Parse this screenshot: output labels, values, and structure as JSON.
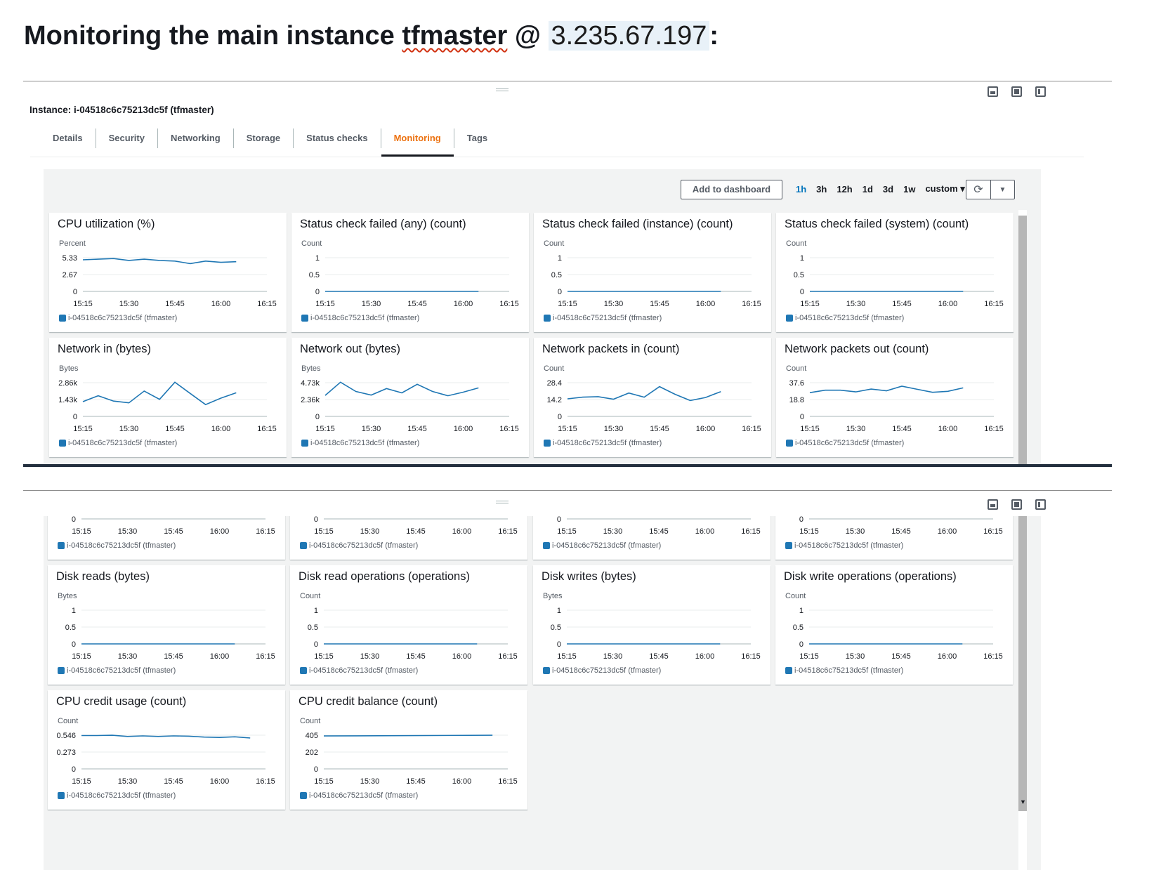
{
  "heading": {
    "prefix": "Monitoring the main instance ",
    "name": "tfmaster",
    "mid": " @ ",
    "ip": "3.235.67.197",
    "suffix": ":"
  },
  "instance_title": "Instance: i-04518c6c75213dc5f (tfmaster)",
  "tabs": [
    {
      "label": "Details",
      "active": false
    },
    {
      "label": "Security",
      "active": false
    },
    {
      "label": "Networking",
      "active": false
    },
    {
      "label": "Storage",
      "active": false
    },
    {
      "label": "Status checks",
      "active": false
    },
    {
      "label": "Monitoring",
      "active": true
    },
    {
      "label": "Tags",
      "active": false
    }
  ],
  "toolbar": {
    "add_to_dashboard": "Add to dashboard",
    "ranges": [
      "1h",
      "3h",
      "12h",
      "1d",
      "3d",
      "1w"
    ],
    "active_range": "1h",
    "custom": "custom ▾",
    "refresh_icon": "refresh-icon",
    "dropdown_icon": "caret-down-icon"
  },
  "colors": {
    "series": "#1f77b4",
    "active_tab": "#ec7211",
    "active_range": "#0073bb"
  },
  "legend_label": "i-04518c6c75213dc5f (tfmaster)",
  "chart_data": [
    {
      "id": "cpu",
      "type": "line",
      "title": "CPU utilization (%)",
      "ylabel": "Percent",
      "yticks": [
        "5.33",
        "2.67",
        "0"
      ],
      "ylim": [
        0,
        5.33
      ],
      "xticks": [
        "15:15",
        "15:30",
        "15:45",
        "16:00",
        "16:15"
      ],
      "series": [
        {
          "name": "i-04518c6c75213dc5f (tfmaster)",
          "x": [
            "15:15",
            "15:20",
            "15:25",
            "15:30",
            "15:35",
            "15:40",
            "15:45",
            "15:50",
            "15:55",
            "16:00",
            "16:05"
          ],
          "values": [
            5.0,
            5.1,
            5.2,
            4.9,
            5.1,
            4.9,
            4.8,
            4.4,
            4.8,
            4.6,
            4.7
          ]
        }
      ]
    },
    {
      "id": "scf_any",
      "type": "line",
      "title": "Status check failed (any) (count)",
      "ylabel": "Count",
      "yticks": [
        "1",
        "0.5",
        "0"
      ],
      "ylim": [
        0,
        1
      ],
      "xticks": [
        "15:15",
        "15:30",
        "15:45",
        "16:00",
        "16:15"
      ],
      "series": [
        {
          "name": "i-04518c6c75213dc5f (tfmaster)",
          "x": [
            "15:15",
            "16:05"
          ],
          "values": [
            0,
            0
          ]
        }
      ]
    },
    {
      "id": "scf_instance",
      "type": "line",
      "title": "Status check failed (instance) (count)",
      "ylabel": "Count",
      "yticks": [
        "1",
        "0.5",
        "0"
      ],
      "ylim": [
        0,
        1
      ],
      "xticks": [
        "15:15",
        "15:30",
        "15:45",
        "16:00",
        "16:15"
      ],
      "series": [
        {
          "name": "i-04518c6c75213dc5f (tfmaster)",
          "x": [
            "15:15",
            "16:05"
          ],
          "values": [
            0,
            0
          ]
        }
      ]
    },
    {
      "id": "scf_system",
      "type": "line",
      "title": "Status check failed (system) (count)",
      "ylabel": "Count",
      "yticks": [
        "1",
        "0.5",
        "0"
      ],
      "ylim": [
        0,
        1
      ],
      "xticks": [
        "15:15",
        "15:30",
        "15:45",
        "16:00",
        "16:15"
      ],
      "series": [
        {
          "name": "i-04518c6c75213dc5f (tfmaster)",
          "x": [
            "15:15",
            "16:05"
          ],
          "values": [
            0,
            0
          ]
        }
      ]
    },
    {
      "id": "net_in",
      "type": "line",
      "title": "Network in (bytes)",
      "ylabel": "Bytes",
      "yticks": [
        "2.86k",
        "1.43k",
        "0"
      ],
      "ylim": [
        0,
        2860
      ],
      "xticks": [
        "15:15",
        "15:30",
        "15:45",
        "16:00",
        "16:15"
      ],
      "series": [
        {
          "name": "i-04518c6c75213dc5f (tfmaster)",
          "x": [
            "15:15",
            "15:20",
            "15:25",
            "15:30",
            "15:35",
            "15:40",
            "15:45",
            "15:50",
            "15:55",
            "16:00",
            "16:05"
          ],
          "values": [
            1250,
            1750,
            1300,
            1150,
            2150,
            1450,
            2900,
            1950,
            1000,
            1550,
            2000
          ]
        }
      ]
    },
    {
      "id": "net_out",
      "type": "line",
      "title": "Network out (bytes)",
      "ylabel": "Bytes",
      "yticks": [
        "4.73k",
        "2.36k",
        "0"
      ],
      "ylim": [
        0,
        4730
      ],
      "xticks": [
        "15:15",
        "15:30",
        "15:45",
        "16:00",
        "16:15"
      ],
      "series": [
        {
          "name": "i-04518c6c75213dc5f (tfmaster)",
          "x": [
            "15:15",
            "15:20",
            "15:25",
            "15:30",
            "15:35",
            "15:40",
            "15:45",
            "15:50",
            "15:55",
            "16:00",
            "16:05"
          ],
          "values": [
            2950,
            4800,
            3500,
            3000,
            3900,
            3300,
            4500,
            3500,
            2900,
            3400,
            4000
          ]
        }
      ]
    },
    {
      "id": "pkts_in",
      "type": "line",
      "title": "Network packets in (count)",
      "ylabel": "Count",
      "yticks": [
        "28.4",
        "14.2",
        "0"
      ],
      "ylim": [
        0,
        28.4
      ],
      "xticks": [
        "15:15",
        "15:30",
        "15:45",
        "16:00",
        "16:15"
      ],
      "series": [
        {
          "name": "i-04518c6c75213dc5f (tfmaster)",
          "x": [
            "15:15",
            "15:20",
            "15:25",
            "15:30",
            "15:35",
            "15:40",
            "15:45",
            "15:50",
            "15:55",
            "16:00",
            "16:05"
          ],
          "values": [
            14.8,
            16.2,
            16.6,
            14.5,
            19.7,
            16.2,
            25.1,
            18.7,
            13.4,
            15.9,
            20.9
          ]
        }
      ]
    },
    {
      "id": "pkts_out",
      "type": "line",
      "title": "Network packets out (count)",
      "ylabel": "Count",
      "yticks": [
        "37.6",
        "18.8",
        "0"
      ],
      "ylim": [
        0,
        37.6
      ],
      "xticks": [
        "15:15",
        "15:30",
        "15:45",
        "16:00",
        "16:15"
      ],
      "series": [
        {
          "name": "i-04518c6c75213dc5f (tfmaster)",
          "x": [
            "15:15",
            "15:20",
            "15:25",
            "15:30",
            "15:35",
            "15:40",
            "15:45",
            "15:50",
            "15:55",
            "16:00",
            "16:05"
          ],
          "values": [
            26.5,
            29.2,
            29.2,
            27.3,
            30.5,
            28.6,
            33.7,
            30.2,
            26.9,
            28.0,
            31.8
          ]
        }
      ]
    },
    {
      "id": "disk_reads",
      "type": "line",
      "title": "Disk reads (bytes)",
      "ylabel": "Bytes",
      "yticks": [
        "1",
        "0.5",
        "0"
      ],
      "ylim": [
        0,
        1
      ],
      "xticks": [
        "15:15",
        "15:30",
        "15:45",
        "16:00",
        "16:15"
      ],
      "series": [
        {
          "name": "i-04518c6c75213dc5f (tfmaster)",
          "x": [
            "15:15",
            "16:05"
          ],
          "values": [
            0,
            0
          ]
        }
      ]
    },
    {
      "id": "disk_read_ops",
      "type": "line",
      "title": "Disk read operations (operations)",
      "ylabel": "Count",
      "yticks": [
        "1",
        "0.5",
        "0"
      ],
      "ylim": [
        0,
        1
      ],
      "xticks": [
        "15:15",
        "15:30",
        "15:45",
        "16:00",
        "16:15"
      ],
      "series": [
        {
          "name": "i-04518c6c75213dc5f (tfmaster)",
          "x": [
            "15:15",
            "16:05"
          ],
          "values": [
            0,
            0
          ]
        }
      ]
    },
    {
      "id": "disk_writes",
      "type": "line",
      "title": "Disk writes (bytes)",
      "ylabel": "Bytes",
      "yticks": [
        "1",
        "0.5",
        "0"
      ],
      "ylim": [
        0,
        1
      ],
      "xticks": [
        "15:15",
        "15:30",
        "15:45",
        "16:00",
        "16:15"
      ],
      "series": [
        {
          "name": "i-04518c6c75213dc5f (tfmaster)",
          "x": [
            "15:15",
            "16:05"
          ],
          "values": [
            0,
            0
          ]
        }
      ]
    },
    {
      "id": "disk_write_ops",
      "type": "line",
      "title": "Disk write operations (operations)",
      "ylabel": "Count",
      "yticks": [
        "1",
        "0.5",
        "0"
      ],
      "ylim": [
        0,
        1
      ],
      "xticks": [
        "15:15",
        "15:30",
        "15:45",
        "16:00",
        "16:15"
      ],
      "series": [
        {
          "name": "i-04518c6c75213dc5f (tfmaster)",
          "x": [
            "15:15",
            "16:05"
          ],
          "values": [
            0,
            0
          ]
        }
      ]
    },
    {
      "id": "cpu_credit_usage",
      "type": "line",
      "title": "CPU credit usage (count)",
      "ylabel": "Count",
      "yticks": [
        "0.546",
        "0.273",
        "0"
      ],
      "ylim": [
        0,
        0.546
      ],
      "xticks": [
        "15:15",
        "15:30",
        "15:45",
        "16:00",
        "16:15"
      ],
      "series": [
        {
          "name": "i-04518c6c75213dc5f (tfmaster)",
          "x": [
            "15:15",
            "15:20",
            "15:25",
            "15:30",
            "15:35",
            "15:40",
            "15:45",
            "15:50",
            "15:55",
            "16:00",
            "16:05",
            "16:10"
          ],
          "values": [
            0.54,
            0.54,
            0.545,
            0.525,
            0.535,
            0.525,
            0.535,
            0.53,
            0.515,
            0.51,
            0.52,
            0.5
          ]
        }
      ]
    },
    {
      "id": "cpu_credit_balance",
      "type": "line",
      "title": "CPU credit balance (count)",
      "ylabel": "Count",
      "yticks": [
        "405",
        "202",
        "0"
      ],
      "ylim": [
        0,
        405
      ],
      "xticks": [
        "15:15",
        "15:30",
        "15:45",
        "16:00",
        "16:15"
      ],
      "series": [
        {
          "name": "i-04518c6c75213dc5f (tfmaster)",
          "x": [
            "15:15",
            "16:10"
          ],
          "values": [
            396,
            404
          ]
        }
      ]
    }
  ]
}
